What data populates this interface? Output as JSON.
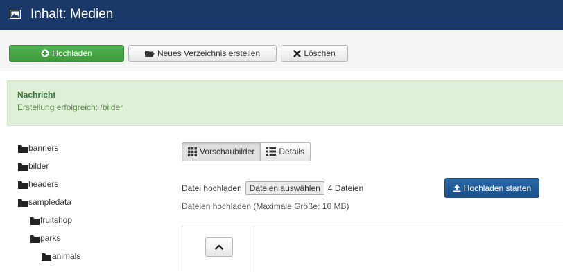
{
  "header": {
    "title": "Inhalt: Medien",
    "icon": "image-icon"
  },
  "toolbar": {
    "upload_label": "Hochladen",
    "new_folder_label": "Neues Verzeichnis erstellen",
    "delete_label": "Löschen"
  },
  "message": {
    "heading": "Nachricht",
    "text": "Erstellung erfolgreich: /bilder"
  },
  "tree": [
    {
      "label": "banners",
      "level": 0
    },
    {
      "label": "bilder",
      "level": 0
    },
    {
      "label": "headers",
      "level": 0
    },
    {
      "label": "sampledata",
      "level": 0
    },
    {
      "label": "fruitshop",
      "level": 1
    },
    {
      "label": "parks",
      "level": 1
    },
    {
      "label": "animals",
      "level": 2
    }
  ],
  "view": {
    "thumbnails_label": "Vorschaubilder",
    "details_label": "Details",
    "active": "thumbnails"
  },
  "upload": {
    "label": "Datei hochladen",
    "choose_button": "Dateien auswählen",
    "file_count": "4 Dateien",
    "start_button": "Hochladen starten",
    "hint": "Dateien hochladen (Maximale Größe: 10 MB)"
  },
  "colors": {
    "header_bg": "#1a3867",
    "success_btn": "#46a546",
    "primary_btn": "#1f5592",
    "message_bg": "#dff0d8"
  }
}
